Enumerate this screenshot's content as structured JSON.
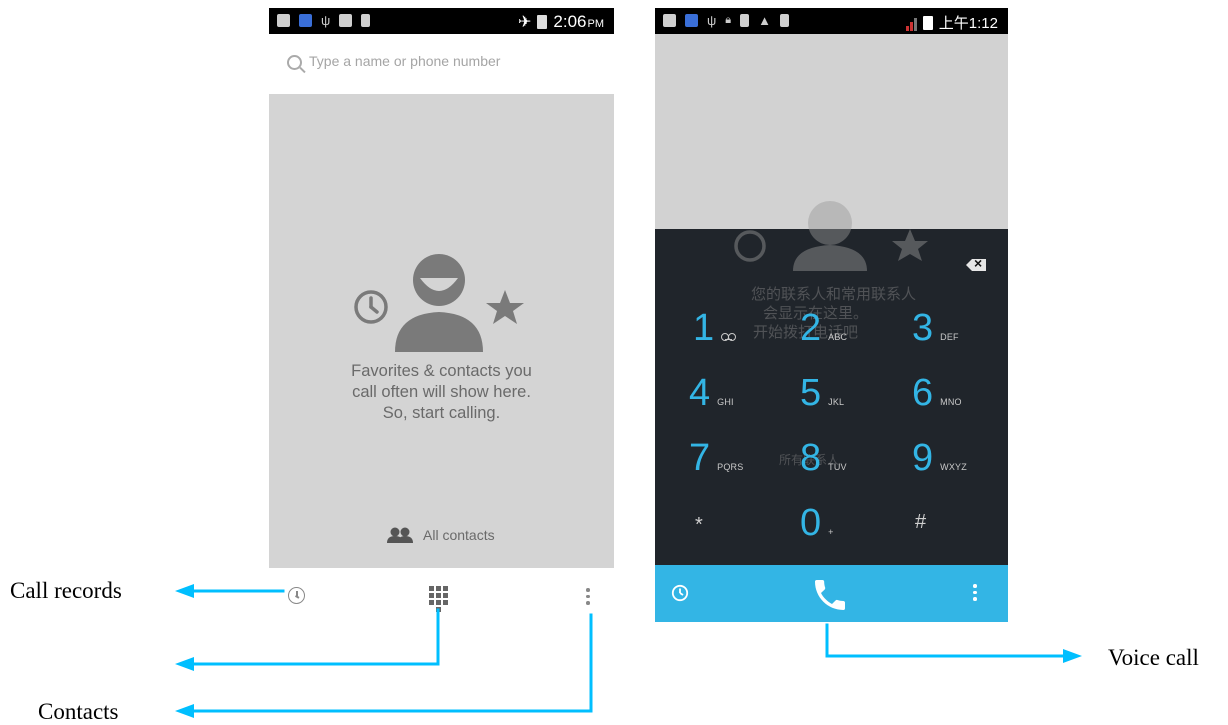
{
  "left_phone": {
    "status_time": "2:06",
    "status_ampm": "PM",
    "search_placeholder": "Type a name or phone number",
    "empty_lines": [
      "Favorites & contacts you",
      "call often will show here.",
      "So, start calling."
    ],
    "all_contacts_label": "All contacts",
    "bottom_icons": [
      "clock-icon",
      "dialpad-icon",
      "overflow-menu-icon"
    ]
  },
  "right_phone": {
    "status_time": "上午1:12",
    "keys": [
      {
        "digit": "1",
        "letters": ""
      },
      {
        "digit": "2",
        "letters": "ABC"
      },
      {
        "digit": "3",
        "letters": "DEF"
      },
      {
        "digit": "4",
        "letters": "GHI"
      },
      {
        "digit": "5",
        "letters": "JKL"
      },
      {
        "digit": "6",
        "letters": "MNO"
      },
      {
        "digit": "7",
        "letters": "PQRS"
      },
      {
        "digit": "8",
        "letters": "TUV"
      },
      {
        "digit": "9",
        "letters": "WXYZ"
      },
      {
        "digit": "*",
        "letters": ""
      },
      {
        "digit": "0",
        "letters": "+"
      },
      {
        "digit": "#",
        "letters": ""
      }
    ],
    "ghost_lines": [
      "您的联系人和常用联系人",
      "会显示在这里。",
      "开始拨打电话吧",
      "所有联系人"
    ],
    "action_icons": [
      "clock-icon",
      "phone-handset-icon",
      "overflow-menu-icon"
    ]
  },
  "callouts": {
    "call_records": "Call records",
    "contacts": "Contacts",
    "voice_call": "Voice call"
  },
  "colors": {
    "accent_blue": "#33b5e5",
    "arrow_cyan": "#00bfff",
    "keypad_dark": "#0c1218",
    "empty_gray": "#d4d4d4"
  }
}
